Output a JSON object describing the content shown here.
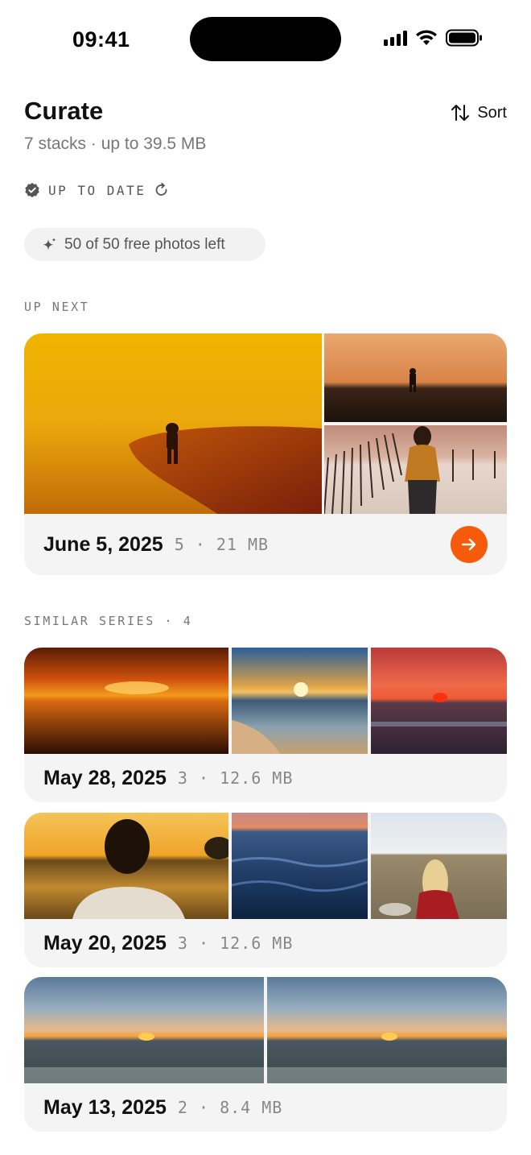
{
  "status_bar": {
    "time": "09:41"
  },
  "header": {
    "title": "Curate",
    "subtitle": "7 stacks · up to 39.5 MB",
    "sort_label": "Sort"
  },
  "sync_status": {
    "label": "UP TO DATE",
    "icon": "verified-badge-icon",
    "refresh_icon": "refresh-icon"
  },
  "free_photos": {
    "label": "50 of 50 free photos left",
    "icon": "sparkle-icon"
  },
  "up_next": {
    "section_label": "UP NEXT",
    "card": {
      "date": "June 5, 2025",
      "meta": "5 · 21 MB",
      "action_icon": "arrow-right-icon",
      "accent": "#f55b0a"
    }
  },
  "similar_series": {
    "section_label": "SIMILAR SERIES · 4",
    "cards": [
      {
        "date": "May 28, 2025",
        "meta": "3 · 12.6 MB"
      },
      {
        "date": "May 20, 2025",
        "meta": "3 · 12.6 MB"
      },
      {
        "date": "May 13, 2025",
        "meta": "2 · 8.4 MB"
      }
    ]
  }
}
